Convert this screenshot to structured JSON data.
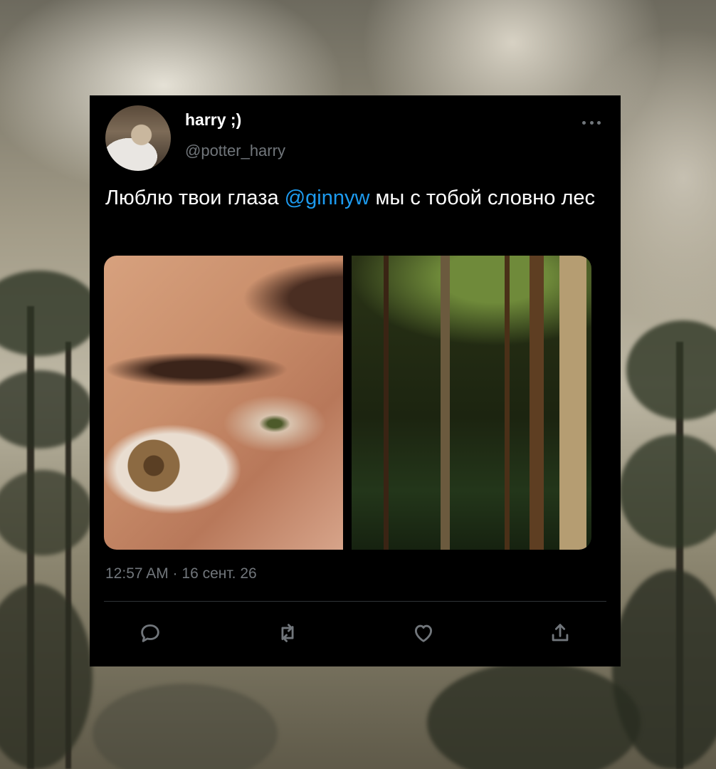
{
  "background": {
    "description_icon": "cloudy-forest-sky-backdrop"
  },
  "tweet": {
    "display_name": "harry ;)",
    "handle": "@potter_harry",
    "text_before": "Люблю твои глаза ",
    "mention": "@ginnyw",
    "text_after": " мы с тобой словно лес",
    "timestamp": "12:57 AM · 16 сент. 26",
    "colors": {
      "background": "#000000",
      "text": "#ffffff",
      "muted": "#71767b",
      "link": "#1d9bf0"
    },
    "actions": [
      {
        "icon": "reply-icon"
      },
      {
        "icon": "retweet-icon"
      },
      {
        "icon": "like-icon"
      },
      {
        "icon": "share-icon"
      }
    ],
    "more_icon": "more-options-icon"
  }
}
